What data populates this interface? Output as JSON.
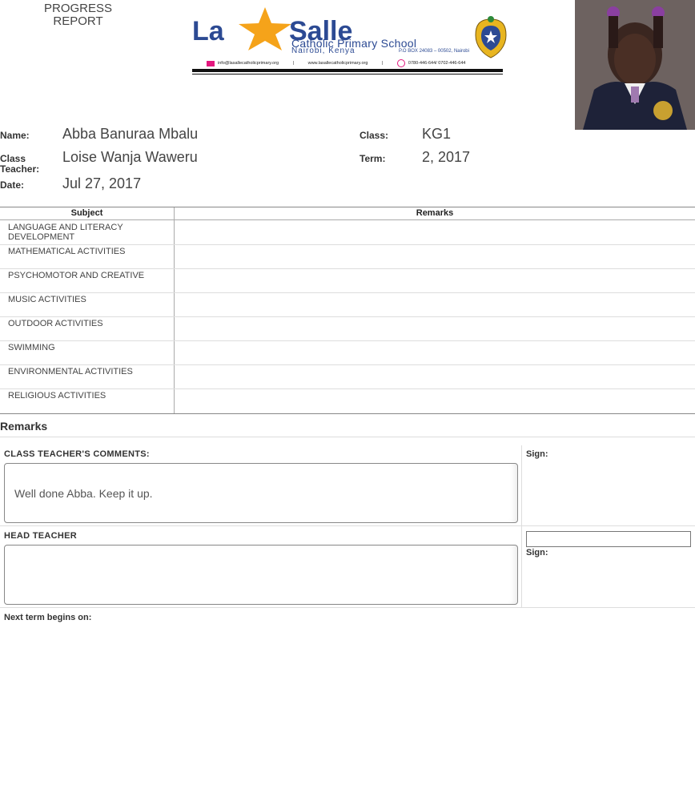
{
  "header": {
    "report_title": "PROGRESS REPORT",
    "logo": {
      "la": "La",
      "salle": "Salle",
      "school_name": "Catholic Primary School",
      "city": "Nairobi, Kenya",
      "pobox": "P.O BOX 24083 – 00502, Nairobi",
      "email": "info@lasallecatholicprimary.org",
      "website": "www.lasallecatholicprimary.org",
      "phone": "0780-446-644/ 0702-446-644",
      "brand_color": "#2c4a93",
      "star_color": "#f5a31a"
    }
  },
  "student": {
    "name_label": "Name:",
    "name": "Abba Banuraa Mbalu",
    "class_label": "Class:",
    "class": "KG1",
    "teacher_label": "Class Teacher:",
    "teacher": "Loise Wanja Waweru",
    "term_label": "Term:",
    "term": "2, 2017",
    "date_label": "Date:",
    "date": "Jul 27, 2017"
  },
  "table": {
    "col_subject": "Subject",
    "col_remarks": "Remarks",
    "rows": [
      {
        "subject": "LANGUAGE AND LITERACY DEVELOPMENT",
        "remark": ""
      },
      {
        "subject": "MATHEMATICAL ACTIVITIES",
        "remark": ""
      },
      {
        "subject": "PSYCHOMOTOR AND CREATIVE",
        "remark": ""
      },
      {
        "subject": "MUSIC ACTIVITIES",
        "remark": ""
      },
      {
        "subject": "OUTDOOR ACTIVITIES",
        "remark": ""
      },
      {
        "subject": "SWIMMING",
        "remark": ""
      },
      {
        "subject": "ENVIRONMENTAL ACTIVITIES",
        "remark": ""
      },
      {
        "subject": "RELIGIOUS ACTIVITIES",
        "remark": ""
      }
    ]
  },
  "remarks": {
    "heading": "Remarks",
    "class_teacher_label": "CLASS TEACHER'S COMMENTS:",
    "class_teacher_comment": "Well done Abba. Keep it up.",
    "sign_label": "Sign:",
    "head_teacher_label": "HEAD TEACHER",
    "head_teacher_comment": "",
    "head_sign_label": "Sign:",
    "head_sign_value": "",
    "next_term_label": "Next term begins on:"
  }
}
